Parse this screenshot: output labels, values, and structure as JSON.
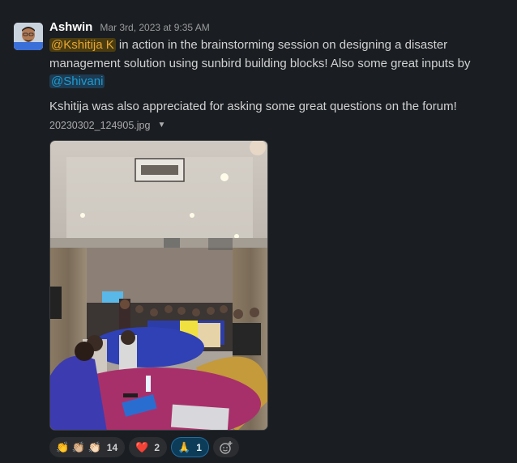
{
  "message": {
    "author": "Ashwin",
    "timestamp": "Mar 3rd, 2023 at 9:35 AM",
    "mention_1": "@Kshitija K",
    "text_1": " in action in the brainstorming session on designing a disaster management solution using sunbird building blocks! Also some great inputs by ",
    "mention_2": "@Shivani",
    "text_2": "Kshitija was also appreciated for asking some great questions on the forum!",
    "file_name": "20230302_124905.jpg",
    "file_caret": "▼"
  },
  "reactions": [
    {
      "emojis": "👏 👏🏼 👏🏻",
      "count": "14"
    },
    {
      "emojis": "❤️",
      "count": "2"
    },
    {
      "emojis": "🙏",
      "count": "1"
    }
  ],
  "colors": {
    "background": "#1a1d21",
    "mention_highlight": "#e8a631",
    "mention_link": "#1d9bd1",
    "active_reaction": "#0d3c58"
  },
  "icons": {
    "add_reaction": "add-emoji-icon",
    "dropdown": "chevron-down-icon"
  }
}
